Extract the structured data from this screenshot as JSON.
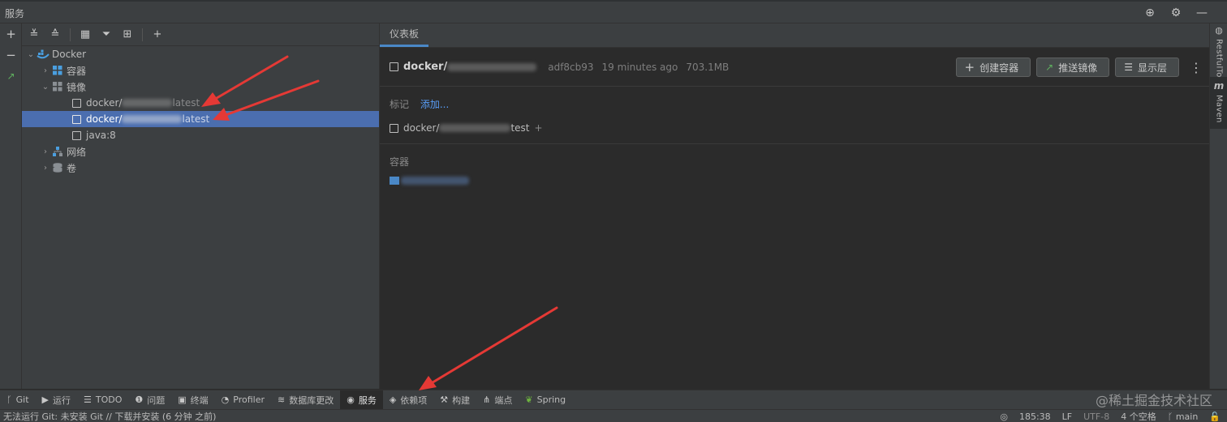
{
  "window": {
    "title": "服务"
  },
  "left_toolbar": {
    "icons": [
      "add-icon",
      "remove-icon",
      "expand-icon"
    ]
  },
  "tree_toolbar": {
    "icons": [
      "expand-all-icon",
      "collapse-all-icon",
      "group-icon",
      "filter-icon",
      "jump-to-source-icon",
      "add-icon"
    ]
  },
  "tree": {
    "root": "Docker",
    "containers": "容器",
    "images": "镜像",
    "image_items": [
      {
        "label": "docker/",
        "tail": "latest"
      },
      {
        "label": "docker/",
        "tail": "latest"
      },
      {
        "label": "java:8",
        "tail": ""
      }
    ],
    "networks": "网络",
    "volumes": "卷"
  },
  "detail": {
    "tab": "仪表板",
    "image_name": "docker/",
    "image_id": "adf8cb93",
    "created": "19 minutes ago",
    "size": "703.1MB",
    "buttons": {
      "create": "创建容器",
      "push": "推送镜像",
      "layers": "显示层"
    },
    "tags_label": "标记",
    "add_link": "添加...",
    "tag_item_prefix": "docker/",
    "tag_item_suffix": "test",
    "containers_label": "容器"
  },
  "right_tabs": [
    "RestfulTool",
    "Maven"
  ],
  "bottom_tools": [
    {
      "label": "Git",
      "icon": "git-branch-icon"
    },
    {
      "label": "运行",
      "icon": "run-icon"
    },
    {
      "label": "TODO",
      "icon": "todo-list-icon"
    },
    {
      "label": "问题",
      "icon": "problems-icon"
    },
    {
      "label": "终端",
      "icon": "terminal-icon"
    },
    {
      "label": "Profiler",
      "icon": "profiler-icon"
    },
    {
      "label": "数据库更改",
      "icon": "database-icon"
    },
    {
      "label": "服务",
      "icon": "services-icon"
    },
    {
      "label": "依赖项",
      "icon": "dependencies-icon"
    },
    {
      "label": "构建",
      "icon": "build-hammer-icon"
    },
    {
      "label": "端点",
      "icon": "endpoints-icon"
    },
    {
      "label": "Spring",
      "icon": "spring-leaf-icon"
    }
  ],
  "status": {
    "message": "无法运行 Git: 未安装 Git // 下载并安装 (6 分钟 之前)",
    "position": "185:38",
    "line_sep": "LF",
    "encoding": "UTF-8",
    "indent": "4 个空格",
    "branch": "main"
  },
  "watermark": "@稀土掘金技术社区"
}
